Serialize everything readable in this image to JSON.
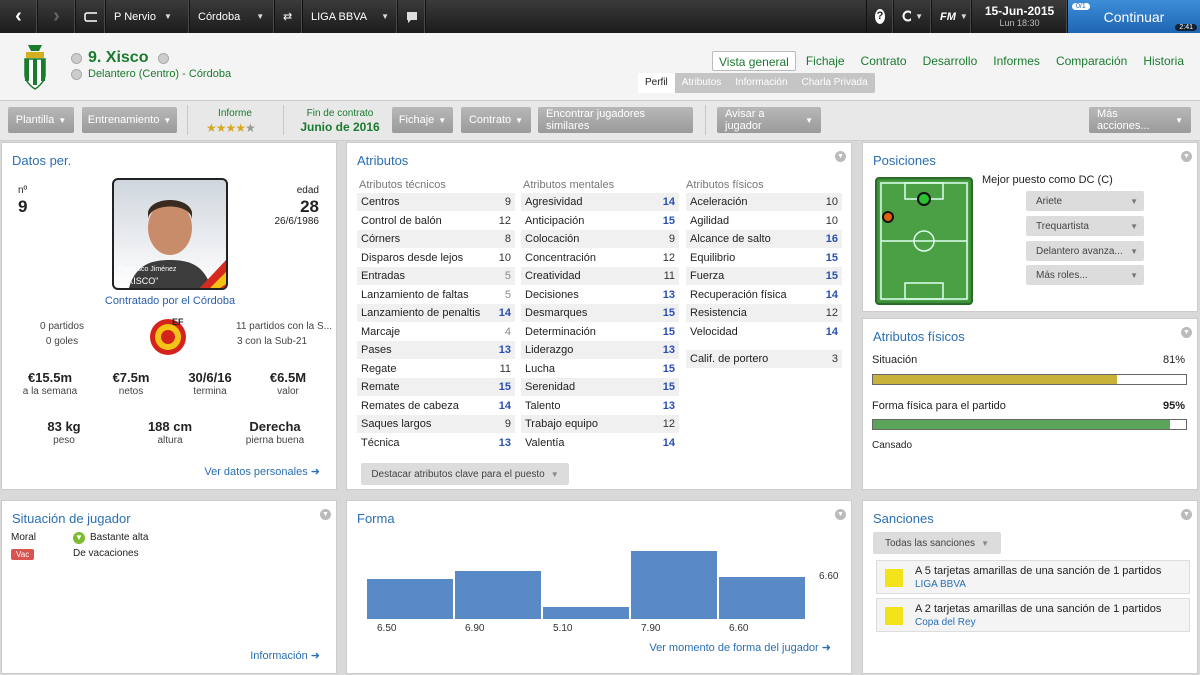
{
  "topbar": {
    "team": "P Nervio",
    "club": "Córdoba",
    "league": "LIGA BBVA",
    "date": "15-Jun-2015",
    "day": "Lun 18:30",
    "logo": "FM",
    "continue": "Continuar",
    "badge": "0/1",
    "timer": "2:41"
  },
  "player": {
    "name": "9. Xisco",
    "role": "Delantero (Centro) - Córdoba",
    "number_label": "nº",
    "number": "9",
    "age_label": "edad",
    "age": "28",
    "dob": "26/6/1986",
    "photo_caption1": "Francisco Jiménez",
    "photo_caption2": "\"XISCO\"",
    "contract_with": "Contratado por el Córdoba"
  },
  "tabs": [
    "Vista general",
    "Fichaje",
    "Contrato",
    "Desarrollo",
    "Informes",
    "Comparación",
    "Historia"
  ],
  "subtabs": [
    "Perfil",
    "Atributos",
    "Información",
    "Charla Privada"
  ],
  "toolbar": {
    "plantilla": "Plantilla",
    "entrenamiento": "Entrenamiento",
    "informe": "Informe",
    "rating_stars": 3.5,
    "fin_label": "Fin de contrato",
    "fin_val": "Junio de 2016",
    "fichaje": "Fichaje",
    "contrato": "Contrato",
    "similares": "Encontrar jugadores similares",
    "avisar": "Avisar a jugador",
    "mas": "Más acciones..."
  },
  "datos": {
    "title": "Datos per.",
    "intl_left1": "0 partidos",
    "intl_left2": "0 goles",
    "intl_right1": "11 partidos con la S...",
    "intl_right2": "3 con la Sub-21",
    "stats": [
      {
        "v": "€15.5m",
        "l": "a la semana"
      },
      {
        "v": "€7.5m",
        "l": "netos"
      },
      {
        "v": "30/6/16",
        "l": "termina"
      },
      {
        "v": "€6.5M",
        "l": "valor"
      }
    ],
    "phys": [
      {
        "v": "83 kg",
        "l": "peso"
      },
      {
        "v": "188 cm",
        "l": "altura"
      },
      {
        "v": "Derecha",
        "l": "pierna buena"
      }
    ],
    "link": "Ver datos personales"
  },
  "atributos": {
    "title": "Atributos",
    "tec_head": "Atributos técnicos",
    "men_head": "Atributos mentales",
    "fis_head": "Atributos físicos",
    "tec": [
      [
        "Centros",
        "9"
      ],
      [
        "Control de balón",
        "12"
      ],
      [
        "Córners",
        "8"
      ],
      [
        "Disparos desde lejos",
        "10"
      ],
      [
        "Entradas",
        "5"
      ],
      [
        "Lanzamiento de faltas",
        "5"
      ],
      [
        "Lanzamiento de penaltis",
        "14"
      ],
      [
        "Marcaje",
        "4"
      ],
      [
        "Pases",
        "13"
      ],
      [
        "Regate",
        "11"
      ],
      [
        "Remate",
        "15"
      ],
      [
        "Remates de cabeza",
        "14"
      ],
      [
        "Saques largos",
        "9"
      ],
      [
        "Técnica",
        "13"
      ]
    ],
    "men": [
      [
        "Agresividad",
        "14"
      ],
      [
        "Anticipación",
        "15"
      ],
      [
        "Colocación",
        "9"
      ],
      [
        "Concentración",
        "12"
      ],
      [
        "Creatividad",
        "11"
      ],
      [
        "Decisiones",
        "13"
      ],
      [
        "Desmarques",
        "15"
      ],
      [
        "Determinación",
        "15"
      ],
      [
        "Liderazgo",
        "13"
      ],
      [
        "Lucha",
        "15"
      ],
      [
        "Serenidad",
        "15"
      ],
      [
        "Talento",
        "13"
      ],
      [
        "Trabajo equipo",
        "12"
      ],
      [
        "Valentía",
        "14"
      ]
    ],
    "fis": [
      [
        "Aceleración",
        "10"
      ],
      [
        "Agilidad",
        "10"
      ],
      [
        "Alcance de salto",
        "16"
      ],
      [
        "Equilibrio",
        "15"
      ],
      [
        "Fuerza",
        "15"
      ],
      [
        "Recuperación física",
        "14"
      ],
      [
        "Resistencia",
        "12"
      ],
      [
        "Velocidad",
        "14"
      ]
    ],
    "gk": [
      "Calif. de portero",
      "3"
    ],
    "button": "Destacar atributos clave para el puesto"
  },
  "posiciones": {
    "title": "Posiciones",
    "best": "Mejor puesto como DC (C)",
    "roles": [
      "Ariete",
      "Trequartista",
      "Delantero avanza...",
      "Más roles..."
    ]
  },
  "fisicos": {
    "title": "Atributos físicos",
    "sit_label": "Situación",
    "sit_val": "81%",
    "sit_fill": 0.78,
    "forma_label": "Forma física para el partido",
    "forma_val": "95%",
    "forma_fill": 0.95,
    "cansado": "Cansado"
  },
  "situacion": {
    "title": "Situación de jugador",
    "moral_label": "Moral",
    "moral_val": "Bastante alta",
    "vac_badge": "Vac",
    "vac_text": "De vacaciones",
    "link": "Información"
  },
  "forma": {
    "title": "Forma",
    "link": "Ver momento de forma del jugador"
  },
  "chart_data": {
    "type": "bar",
    "values": [
      6.5,
      6.9,
      5.1,
      7.9,
      6.6,
      6.6
    ],
    "labels": [
      "6.50",
      "6.90",
      "5.10",
      "7.90",
      "6.60",
      "6.60"
    ],
    "ylim": [
      4.5,
      8
    ]
  },
  "sanciones": {
    "title": "Sanciones",
    "filter": "Todas las sanciones",
    "items": [
      {
        "t": "A 5 tarjetas amarillas de una sanción de 1 partidos",
        "l": "LIGA BBVA"
      },
      {
        "t": "A 2 tarjetas amarillas de una sanción de 1 partidos",
        "l": "Copa del Rey"
      }
    ]
  },
  "colors": {
    "green": "#1a7a2e",
    "blue": "#2a6fb3",
    "bar": "#5a89c8",
    "gold": "#c9b23a",
    "fit": "#5aa55a"
  }
}
